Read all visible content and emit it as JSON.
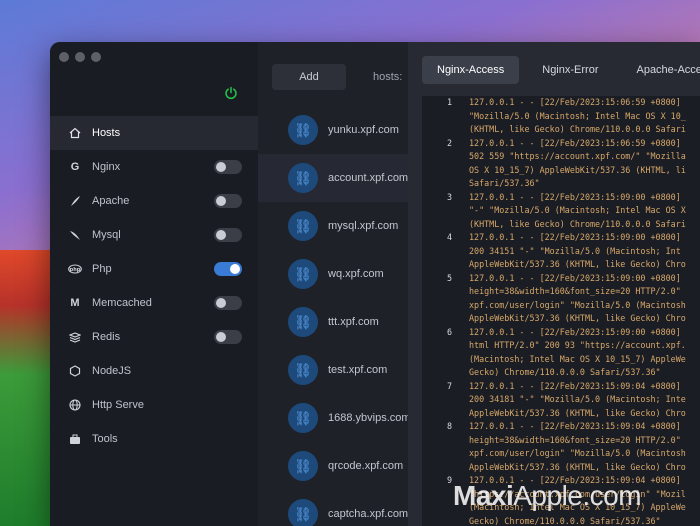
{
  "sidebar": {
    "items": [
      {
        "label": "Hosts",
        "icon": "home-icon",
        "toggle": null
      },
      {
        "label": "Nginx",
        "icon": "nginx-icon",
        "toggle": false
      },
      {
        "label": "Apache",
        "icon": "apache-feather-icon",
        "toggle": false
      },
      {
        "label": "Mysql",
        "icon": "mysql-dolphin-icon",
        "toggle": false
      },
      {
        "label": "Php",
        "icon": "php-icon",
        "toggle": true
      },
      {
        "label": "Memcached",
        "icon": "memcached-icon",
        "toggle": false
      },
      {
        "label": "Redis",
        "icon": "redis-icon",
        "toggle": false
      },
      {
        "label": "NodeJS",
        "icon": "nodejs-icon",
        "toggle": null
      },
      {
        "label": "Http Serve",
        "icon": "globe-icon",
        "toggle": null
      },
      {
        "label": "Tools",
        "icon": "toolbox-icon",
        "toggle": null
      }
    ]
  },
  "sites": {
    "add_label": "Add",
    "hosts_label": "hosts:",
    "items": [
      "yunku.xpf.com",
      "account.xpf.com",
      "mysql.xpf.com",
      "wq.xpf.com",
      "ttt.xpf.com",
      "test.xpf.com",
      "1688.ybvips.com",
      "qrcode.xpf.com",
      "captcha.xpf.com"
    ]
  },
  "logs": {
    "tabs": [
      "Nginx-Access",
      "Nginx-Error",
      "Apache-Access"
    ],
    "lines": [
      {
        "n": "1",
        "t": "127.0.0.1 - - [22/Feb/2023:15:06:59 +0800]"
      },
      {
        "n": "",
        "t": "\"Mozilla/5.0 (Macintosh; Intel Mac OS X 10_"
      },
      {
        "n": "",
        "t": "(KHTML, like Gecko) Chrome/110.0.0.0 Safari"
      },
      {
        "n": "2",
        "t": "127.0.0.1 - - [22/Feb/2023:15:06:59 +0800]"
      },
      {
        "n": "",
        "t": "502 559 \"https://account.xpf.com/\" \"Mozilla"
      },
      {
        "n": "",
        "t": "OS X 10_15_7) AppleWebKit/537.36 (KHTML, li"
      },
      {
        "n": "",
        "t": "Safari/537.36\""
      },
      {
        "n": "3",
        "t": "127.0.0.1 - - [22/Feb/2023:15:09:00 +0800]"
      },
      {
        "n": "",
        "t": "\"-\" \"Mozilla/5.0 (Macintosh; Intel Mac OS X"
      },
      {
        "n": "",
        "t": "(KHTML, like Gecko) Chrome/110.0.0.0 Safari"
      },
      {
        "n": "4",
        "t": "127.0.0.1 - - [22/Feb/2023:15:09:00 +0800]"
      },
      {
        "n": "",
        "t": "200 34151 \"-\" \"Mozilla/5.0 (Macintosh; Int"
      },
      {
        "n": "",
        "t": "AppleWebKit/537.36 (KHTML, like Gecko) Chro"
      },
      {
        "n": "5",
        "t": "127.0.0.1 - - [22/Feb/2023:15:09:00 +0800]"
      },
      {
        "n": "",
        "t": "height=38&width=160&font_size=20 HTTP/2.0\""
      },
      {
        "n": "",
        "t": "xpf.com/user/login\" \"Mozilla/5.0 (Macintosh"
      },
      {
        "n": "",
        "t": "AppleWebKit/537.36 (KHTML, like Gecko) Chro"
      },
      {
        "n": "6",
        "t": "127.0.0.1 - - [22/Feb/2023:15:09:00 +0800]"
      },
      {
        "n": "",
        "t": "html HTTP/2.0\" 200 93 \"https://account.xpf."
      },
      {
        "n": "",
        "t": "(Macintosh; Intel Mac OS X 10_15_7) AppleWe"
      },
      {
        "n": "",
        "t": "Gecko) Chrome/110.0.0.0 Safari/537.36\""
      },
      {
        "n": "7",
        "t": "127.0.0.1 - - [22/Feb/2023:15:09:04 +0800]"
      },
      {
        "n": "",
        "t": "200 34181 \"-\" \"Mozilla/5.0 (Macintosh; Inte"
      },
      {
        "n": "",
        "t": "AppleWebKit/537.36 (KHTML, like Gecko) Chro"
      },
      {
        "n": "8",
        "t": "127.0.0.1 - - [22/Feb/2023:15:09:04 +0800]"
      },
      {
        "n": "",
        "t": "height=38&width=160&font_size=20 HTTP/2.0\""
      },
      {
        "n": "",
        "t": "xpf.com/user/login\" \"Mozilla/5.0 (Macintosh"
      },
      {
        "n": "",
        "t": "AppleWebKit/537.36 (KHTML, like Gecko) Chro"
      },
      {
        "n": "9",
        "t": "127.0.0.1 - - [22/Feb/2023:15:09:04 +0800]"
      },
      {
        "n": "",
        "t": "\"https://account.xpf.com/user/login\" \"Mozil"
      },
      {
        "n": "",
        "t": "(Macintosh; Intel Mac OS X 10_15_7) AppleWe"
      },
      {
        "n": "",
        "t": "Gecko) Chrome/110.0.0.0 Safari/537.36\""
      }
    ]
  },
  "watermark": {
    "bold": "Maxi",
    "thin": "Apple.com"
  },
  "colors": {
    "accent": "#3a7bd5",
    "power": "#27c24c",
    "log_text": "#d7a86a"
  }
}
